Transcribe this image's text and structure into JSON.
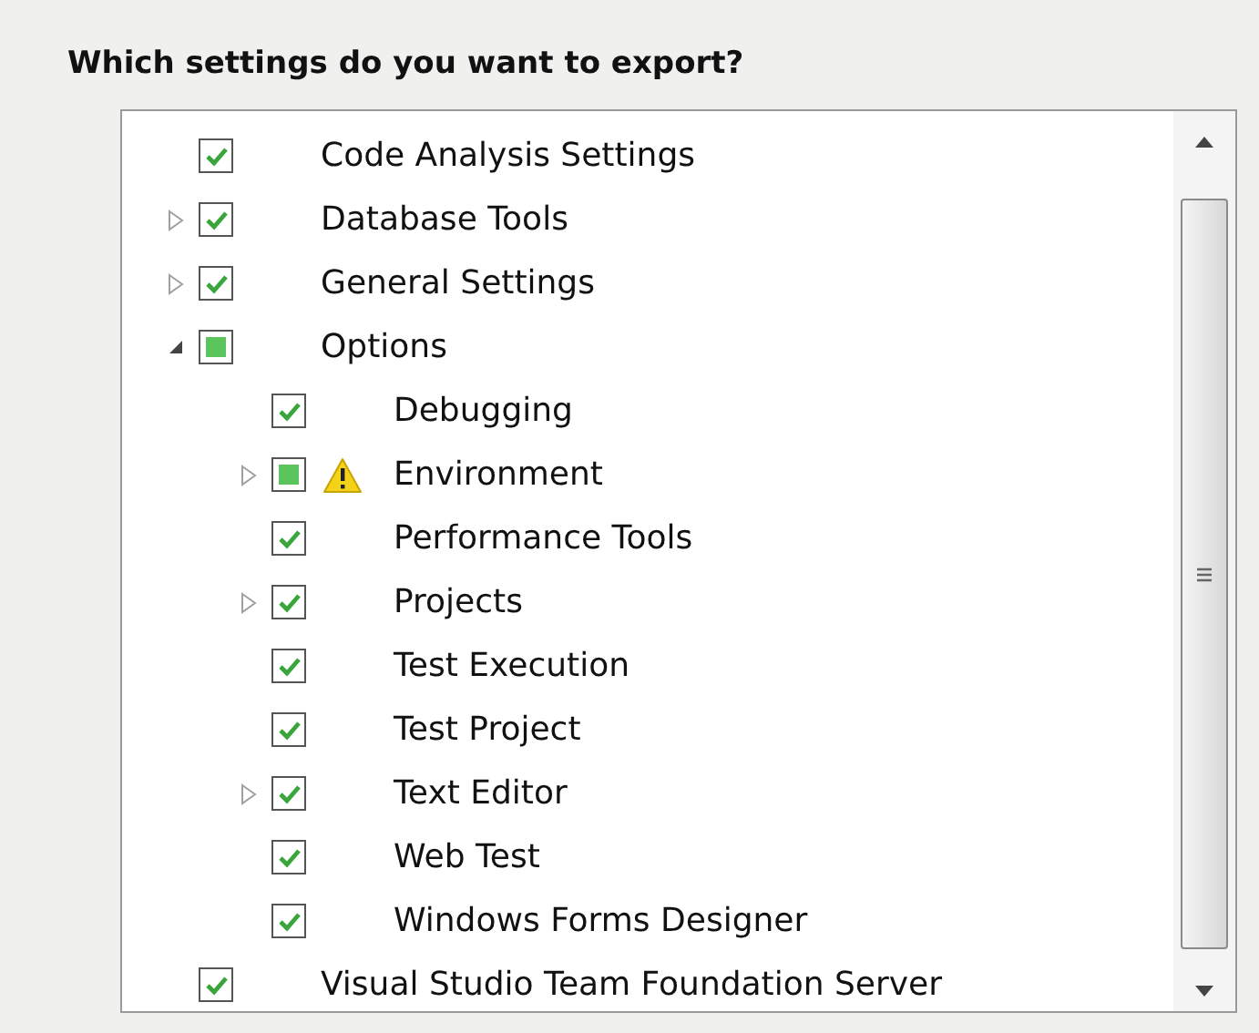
{
  "heading": "Which settings do you want to export?",
  "tree": [
    {
      "label": "Code Analysis Settings",
      "checked": true
    },
    {
      "label": "Database Tools",
      "checked": true,
      "expanded": false
    },
    {
      "label": "General Settings",
      "checked": true,
      "expanded": false
    },
    {
      "label": "Options",
      "checked": false,
      "partial": true,
      "expanded": true,
      "children": [
        {
          "label": "Debugging",
          "checked": true
        },
        {
          "label": "Environment",
          "checked": false,
          "partial": true,
          "expanded": false,
          "warning": true
        },
        {
          "label": "Performance Tools",
          "checked": true
        },
        {
          "label": "Projects",
          "checked": true,
          "expanded": false
        },
        {
          "label": "Test Execution",
          "checked": true
        },
        {
          "label": "Test Project",
          "checked": true
        },
        {
          "label": "Text Editor",
          "checked": true,
          "expanded": false
        },
        {
          "label": "Web Test",
          "checked": true
        },
        {
          "label": "Windows Forms Designer",
          "checked": true
        }
      ]
    },
    {
      "label": "Visual Studio Team Foundation Server",
      "checked": true
    }
  ]
}
